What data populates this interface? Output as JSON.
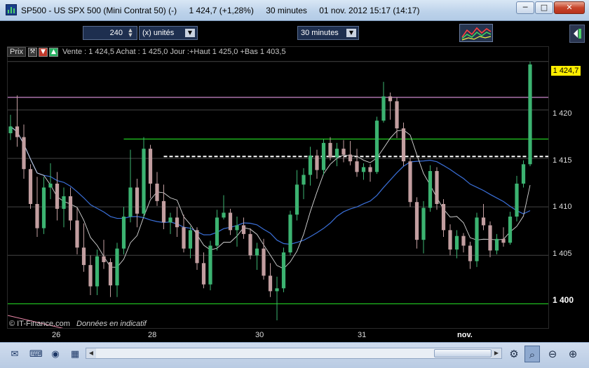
{
  "window": {
    "symbol": "SP500 - US SPX 500 (Mini Contrat 50) (-)",
    "last_change": "1 424,7 (+1,28%)",
    "period": "30 minutes",
    "datetime": "01 nov. 2012 15:17 (14:17)",
    "minimize_glyph": "─",
    "maximize_glyph": "□",
    "close_glyph": "✕"
  },
  "toolbar": {
    "units_count": "240",
    "units_label": "(x) unités",
    "period_label": "30 minutes",
    "dropdown_glyph": "▼",
    "spin_up": "▲",
    "spin_down": "▼"
  },
  "chart_header": {
    "prix_label": "Prix",
    "quote": "Vente : 1 424,5  Achat : 1 425,0  Jour :+Haut 1 425,0  +Bas 1 403,5"
  },
  "watermark": {
    "brand": "© IT-Finance.com",
    "note": "Données en indicatif"
  },
  "colors": {
    "bull": "#3cb371",
    "bear": "#c29ea0",
    "ma_fast": "#d8d8d8",
    "ma_slow": "#3a6fd8",
    "support": "#22cc22",
    "resistance": "#cc88cc",
    "current_price_bg": "#ffee00",
    "trendline": "#ee88aa"
  },
  "chart_data": {
    "type": "candlestick",
    "y_ticks": [
      "1 400",
      "1 405",
      "1 410",
      "1 415",
      "1 420"
    ],
    "current_price": "1 424,7",
    "x_ticks": [
      "26",
      "28",
      "30",
      "31",
      "nov."
    ],
    "ylim": [
      1397.5,
      1426.5
    ],
    "horizontal_levels": [
      {
        "value": 1421.3,
        "style": "solid",
        "color": "resistance"
      },
      {
        "value": 1417.0,
        "style": "solid",
        "color": "support"
      },
      {
        "value": 1415.2,
        "style": "dashed",
        "color": "white"
      },
      {
        "value": 1400.0,
        "style": "solid",
        "color": "support"
      }
    ],
    "candles": [
      [
        1417.6,
        1419.5,
        1416.9,
        1418.3
      ],
      [
        1418.3,
        1421.5,
        1416.2,
        1417.2
      ],
      [
        1417.2,
        1418.5,
        1412.9,
        1413.9
      ],
      [
        1413.9,
        1414.4,
        1409.8,
        1410.3
      ],
      [
        1410.3,
        1413.1,
        1406.9,
        1407.8
      ],
      [
        1407.8,
        1413.1,
        1407.2,
        1412.0
      ],
      [
        1412.0,
        1414.5,
        1410.8,
        1412.4
      ],
      [
        1412.4,
        1413.6,
        1408.6,
        1409.8
      ],
      [
        1409.8,
        1412.0,
        1407.9,
        1411.1
      ],
      [
        1411.1,
        1412.0,
        1407.6,
        1408.6
      ],
      [
        1408.6,
        1409.9,
        1405.1,
        1405.8
      ],
      [
        1405.8,
        1408.3,
        1403.3,
        1404.0
      ],
      [
        1404.0,
        1405.0,
        1400.9,
        1401.8
      ],
      [
        1401.8,
        1405.6,
        1400.9,
        1404.9
      ],
      [
        1404.9,
        1406.6,
        1403.6,
        1404.3
      ],
      [
        1404.3,
        1404.7,
        1400.7,
        1401.9
      ],
      [
        1401.9,
        1406.3,
        1400.7,
        1405.7
      ],
      [
        1405.7,
        1410.0,
        1405.1,
        1409.0
      ],
      [
        1409.0,
        1415.9,
        1408.4,
        1412.0
      ],
      [
        1412.0,
        1412.9,
        1407.9,
        1409.3
      ],
      [
        1409.3,
        1417.2,
        1408.9,
        1416.0
      ],
      [
        1416.0,
        1416.4,
        1410.9,
        1412.4
      ],
      [
        1412.4,
        1413.6,
        1410.1,
        1410.6
      ],
      [
        1410.6,
        1412.3,
        1407.7,
        1408.4
      ],
      [
        1408.4,
        1409.4,
        1407.2,
        1408.9
      ],
      [
        1408.9,
        1410.0,
        1406.9,
        1407.9
      ],
      [
        1407.9,
        1409.2,
        1405.3,
        1405.7
      ],
      [
        1405.7,
        1408.0,
        1404.7,
        1407.6
      ],
      [
        1407.6,
        1407.9,
        1403.5,
        1404.2
      ],
      [
        1404.2,
        1405.3,
        1401.6,
        1402.0
      ],
      [
        1402.0,
        1406.5,
        1401.4,
        1406.0
      ],
      [
        1406.0,
        1409.7,
        1405.5,
        1408.9
      ],
      [
        1408.9,
        1411.2,
        1408.7,
        1409.4
      ],
      [
        1409.4,
        1409.8,
        1407.1,
        1407.6
      ],
      [
        1407.6,
        1409.0,
        1405.9,
        1408.1
      ],
      [
        1408.1,
        1408.9,
        1406.7,
        1407.2
      ],
      [
        1407.2,
        1407.8,
        1404.6,
        1405.0
      ],
      [
        1405.0,
        1406.3,
        1403.5,
        1405.7
      ],
      [
        1405.7,
        1406.7,
        1402.5,
        1402.9
      ],
      [
        1402.9,
        1404.2,
        1400.7,
        1401.3
      ],
      [
        1401.3,
        1402.8,
        1398.3,
        1401.6
      ],
      [
        1401.6,
        1405.8,
        1401.2,
        1405.3
      ],
      [
        1405.3,
        1409.6,
        1405.0,
        1409.2
      ],
      [
        1409.2,
        1413.8,
        1408.6,
        1412.3
      ],
      [
        1412.3,
        1414.0,
        1410.8,
        1413.3
      ],
      [
        1413.3,
        1416.2,
        1412.2,
        1415.3
      ],
      [
        1415.3,
        1415.9,
        1412.9,
        1413.8
      ],
      [
        1413.8,
        1417.0,
        1413.3,
        1416.6
      ],
      [
        1416.6,
        1417.2,
        1414.8,
        1415.1
      ],
      [
        1415.1,
        1416.6,
        1414.2,
        1416.0
      ],
      [
        1416.0,
        1416.9,
        1414.6,
        1415.4
      ],
      [
        1415.4,
        1416.8,
        1414.3,
        1414.7
      ],
      [
        1414.7,
        1416.0,
        1413.1,
        1413.6
      ],
      [
        1413.6,
        1414.5,
        1412.8,
        1414.1
      ],
      [
        1414.1,
        1414.4,
        1412.6,
        1413.6
      ],
      [
        1413.6,
        1419.3,
        1413.4,
        1418.9
      ],
      [
        1418.9,
        1422.9,
        1418.7,
        1421.4
      ],
      [
        1421.4,
        1421.8,
        1419.0,
        1420.9
      ],
      [
        1420.9,
        1421.3,
        1417.1,
        1418.1
      ],
      [
        1418.1,
        1418.7,
        1414.2,
        1414.7
      ],
      [
        1414.7,
        1415.1,
        1410.0,
        1410.5
      ],
      [
        1410.5,
        1411.0,
        1405.7,
        1406.6
      ],
      [
        1406.6,
        1410.6,
        1405.2,
        1409.9
      ],
      [
        1409.9,
        1414.3,
        1409.5,
        1413.7
      ],
      [
        1413.7,
        1414.1,
        1409.7,
        1410.3
      ],
      [
        1410.3,
        1410.8,
        1406.9,
        1407.6
      ],
      [
        1407.6,
        1408.2,
        1405.0,
        1405.6
      ],
      [
        1405.6,
        1407.6,
        1404.7,
        1407.0
      ],
      [
        1407.0,
        1407.3,
        1405.3,
        1406.0
      ],
      [
        1406.0,
        1406.4,
        1403.6,
        1404.4
      ],
      [
        1404.4,
        1409.4,
        1403.8,
        1408.9
      ],
      [
        1408.9,
        1410.3,
        1407.6,
        1408.1
      ],
      [
        1408.1,
        1408.5,
        1404.8,
        1405.5
      ],
      [
        1405.5,
        1407.2,
        1405.1,
        1406.7
      ],
      [
        1406.7,
        1407.9,
        1405.9,
        1406.3
      ],
      [
        1406.3,
        1409.5,
        1406.1,
        1409.0
      ],
      [
        1409.0,
        1413.2,
        1408.5,
        1412.4
      ],
      [
        1412.4,
        1414.8,
        1412.0,
        1414.4
      ],
      [
        1414.4,
        1425.0,
        1414.2,
        1424.7
      ]
    ]
  }
}
